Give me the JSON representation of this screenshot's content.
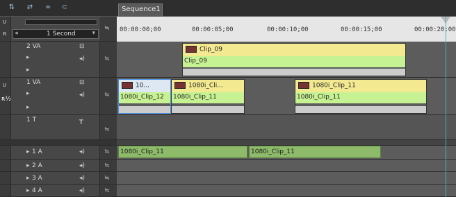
{
  "sequence_tab": "Sequence1",
  "zoom_label": "1 Second",
  "timecodes": [
    "00:00:00;00",
    "00:00:05;00",
    "00:00:10;00",
    "00:00:15;00",
    "00:00:20;00"
  ],
  "tracks": {
    "va2": {
      "label": "2 VA",
      "clip_name": "Clip_09",
      "clip_name2": "Clip_09"
    },
    "va1": {
      "label": "1 VA",
      "clips": [
        {
          "top": "10...",
          "bottom": "1080i_Clip_12"
        },
        {
          "top": "1080i_Cli...",
          "bottom": "1080i_Clip_11"
        },
        {
          "top": "1080i_Clip_11",
          "bottom": "1080i_Clip_11"
        }
      ]
    },
    "t1": {
      "label": "1 T"
    },
    "audio": [
      {
        "label": "1 A",
        "clips": [
          "1080i_Clip_11",
          "1080i_Clip_11"
        ]
      },
      {
        "label": "2 A"
      },
      {
        "label": "3 A"
      },
      {
        "label": "4 A"
      }
    ]
  }
}
